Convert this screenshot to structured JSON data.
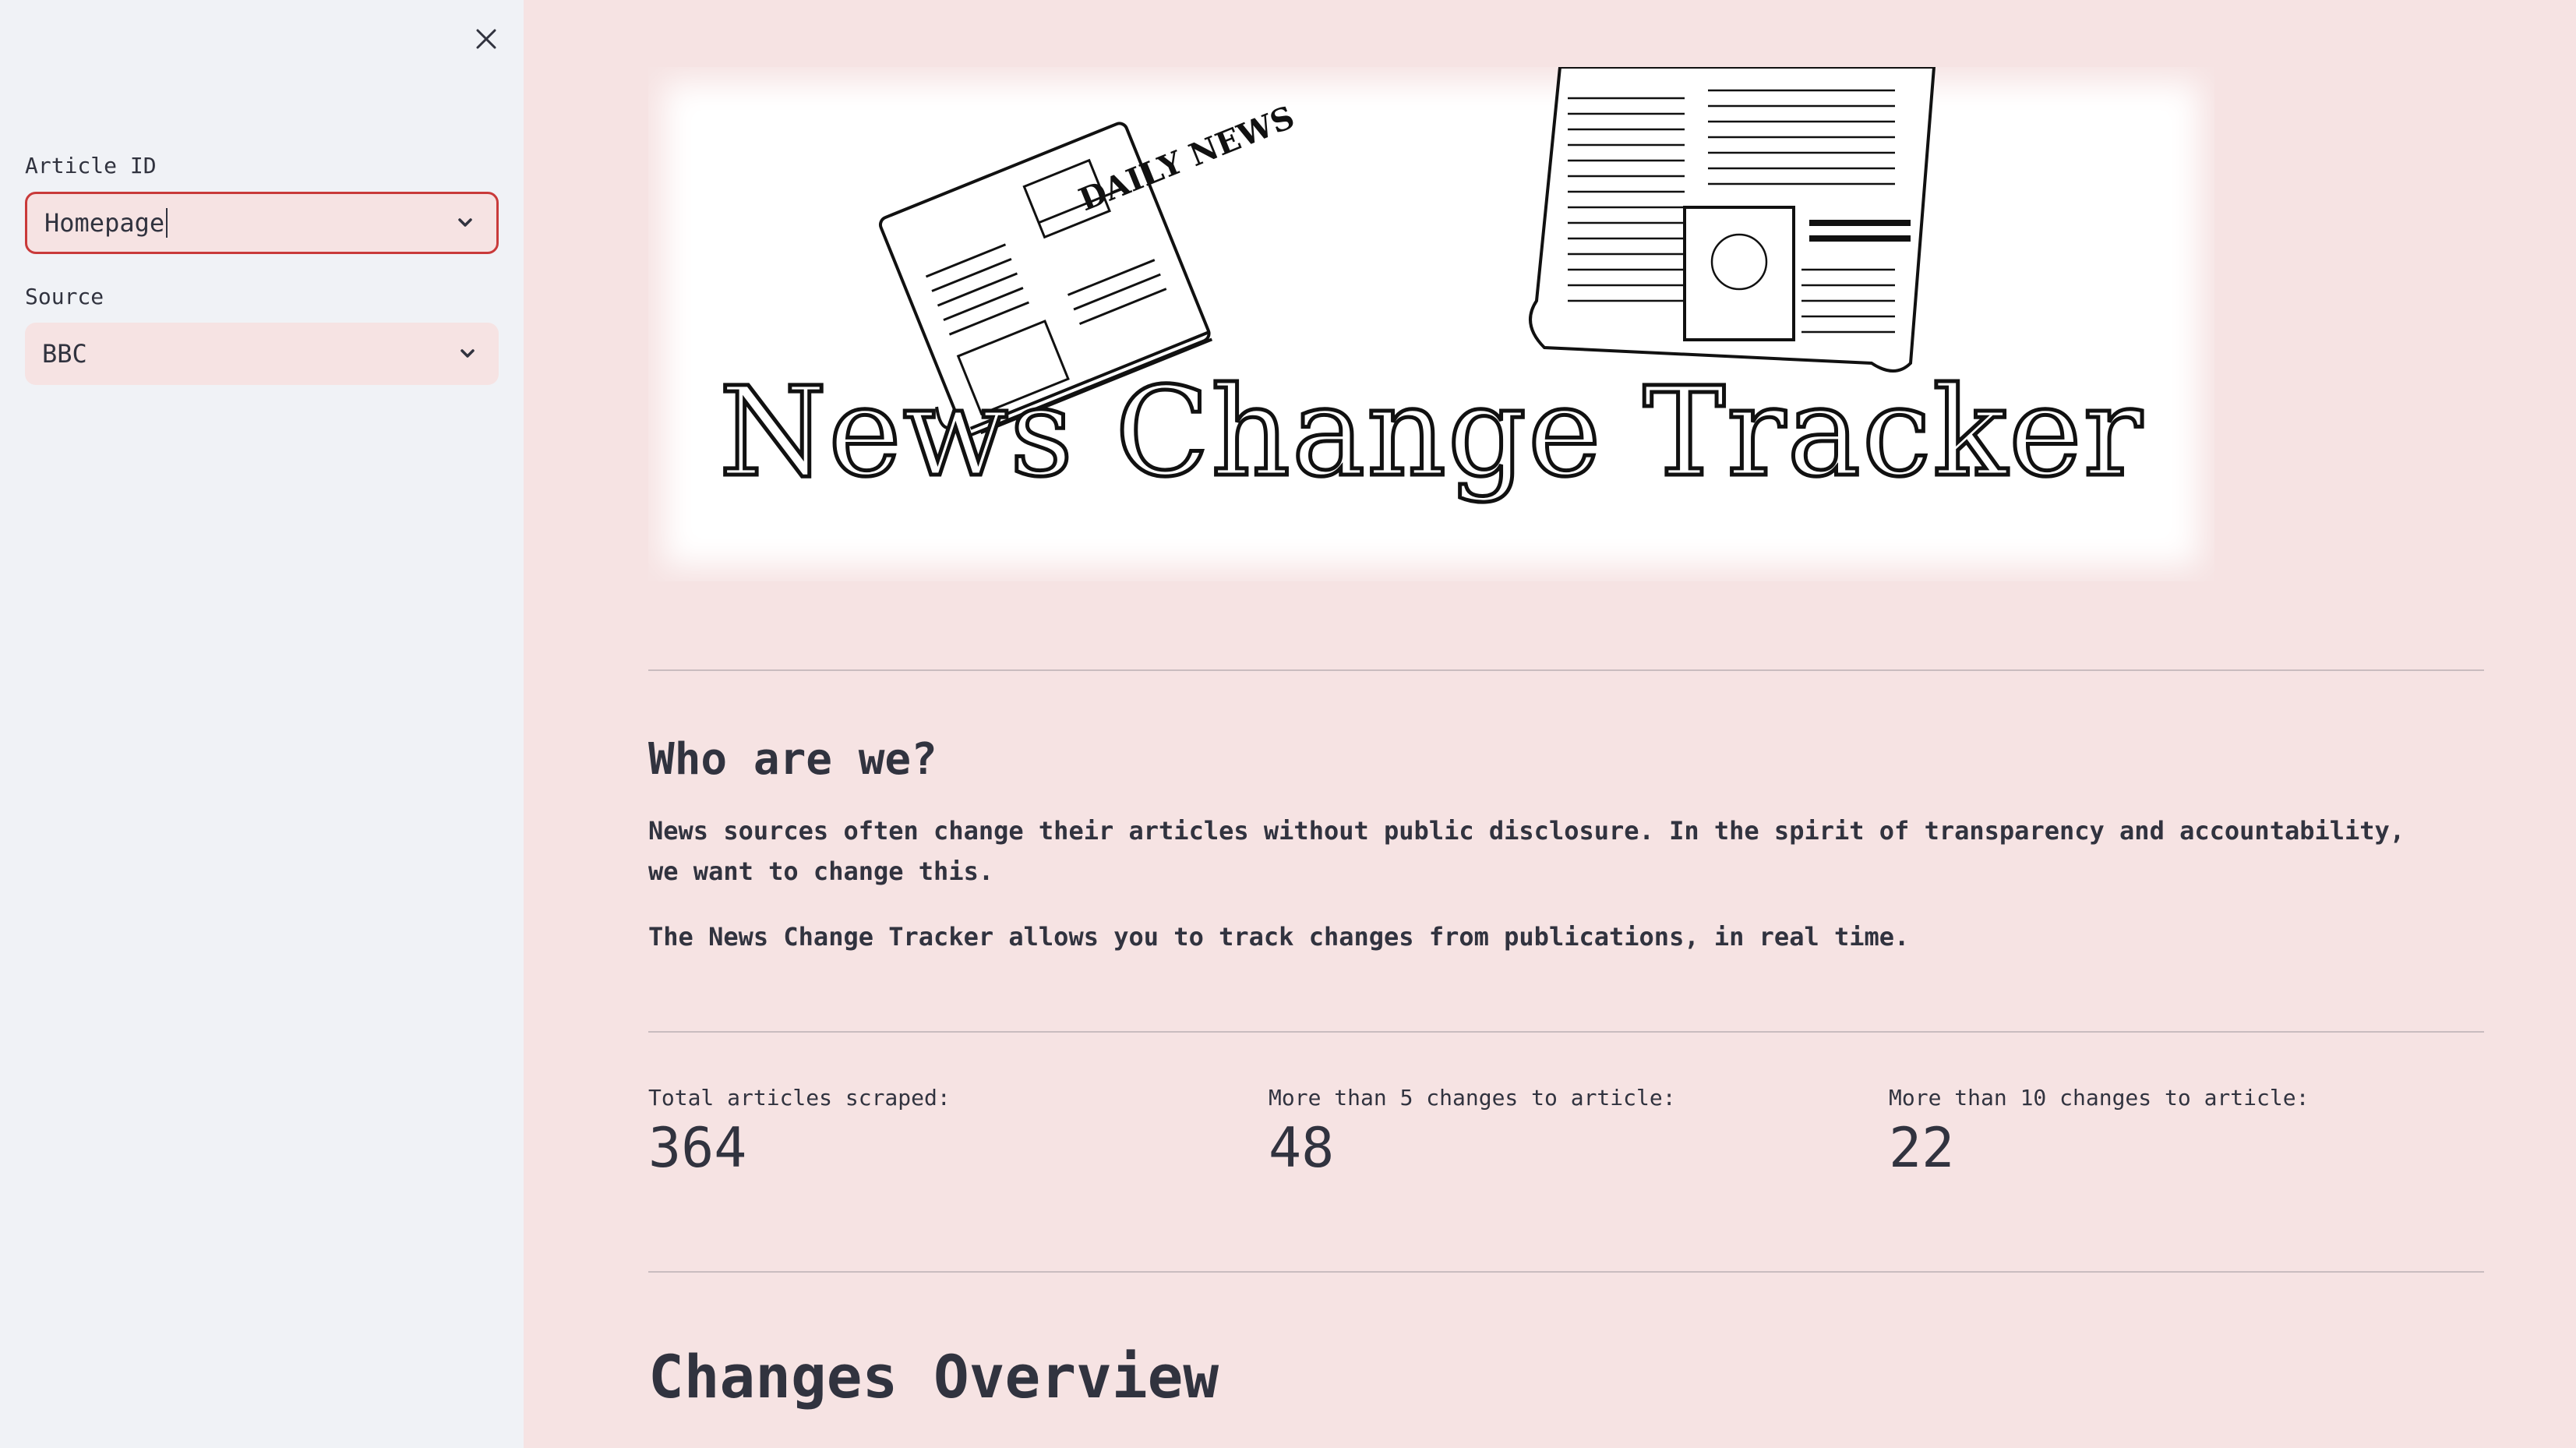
{
  "sidebar": {
    "article_id": {
      "label": "Article ID",
      "value": "Homepage"
    },
    "source": {
      "label": "Source",
      "value": "BBC"
    }
  },
  "banner": {
    "title": "News Change Tracker",
    "newspaper_text": "DAILY NEWS"
  },
  "about": {
    "heading": "Who are we?",
    "paragraph1": "News sources often change their articles without public disclosure. In the spirit of transparency and accountability, we want to change this.",
    "paragraph2": "The News Change Tracker allows you to track changes from publications, in real time."
  },
  "metrics": [
    {
      "label": "Total articles scraped:",
      "value": "364"
    },
    {
      "label": "More than 5 changes to article:",
      "value": "48"
    },
    {
      "label": "More than 10 changes to article:",
      "value": "22"
    }
  ],
  "overview": {
    "heading": "Changes Overview"
  },
  "colors": {
    "background": "#f6e3e3",
    "sidebar": "#f0f2f6",
    "focus_border": "#c93a3a",
    "text": "#31333f"
  }
}
